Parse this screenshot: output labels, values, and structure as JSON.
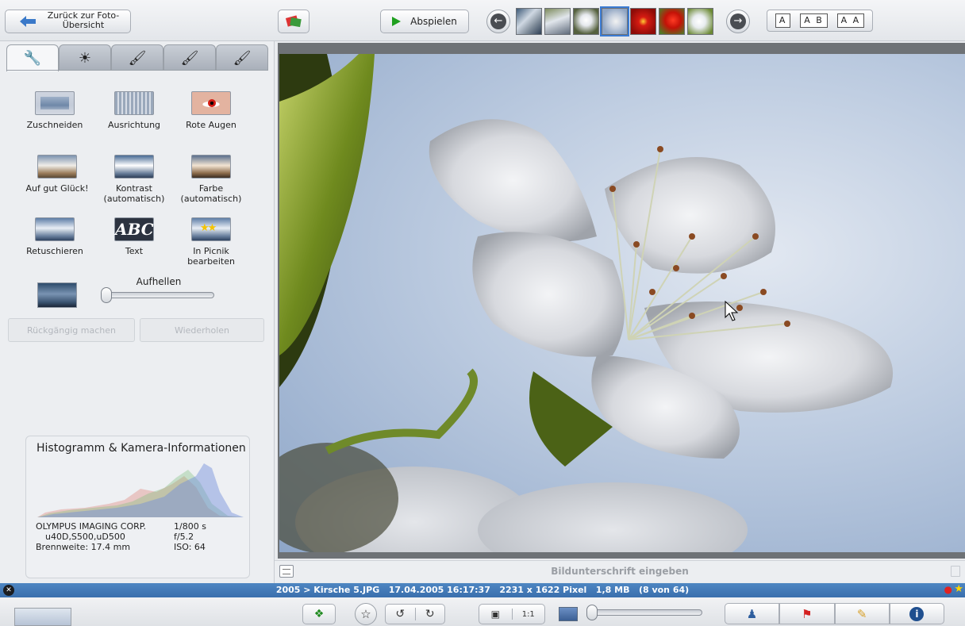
{
  "toolbar": {
    "back_label": "Zurück zur Foto-\nÜbersicht",
    "play_label": "Abspielen",
    "layout_options": [
      "A",
      "A B",
      "A A"
    ],
    "filmstrip": [
      {
        "name": "thumbnail-1"
      },
      {
        "name": "thumbnail-2"
      },
      {
        "name": "thumbnail-3"
      },
      {
        "name": "thumbnail-4",
        "selected": true
      },
      {
        "name": "thumbnail-5"
      },
      {
        "name": "thumbnail-6"
      },
      {
        "name": "thumbnail-7"
      }
    ]
  },
  "edit_panel": {
    "tabs": [
      {
        "icon": "wrench-icon",
        "glyph": "⚒"
      },
      {
        "icon": "sun-icon",
        "glyph": "✹"
      },
      {
        "icon": "brush-icon",
        "glyph": "✒"
      },
      {
        "icon": "brush-picture-icon",
        "glyph": "✒"
      },
      {
        "icon": "brush-picture-blue-icon",
        "glyph": "✒"
      }
    ],
    "tools": [
      {
        "label": "Zuschneiden"
      },
      {
        "label": "Ausrichtung"
      },
      {
        "label": "Rote Augen"
      },
      {
        "label": "Auf gut Glück!"
      },
      {
        "label": "Kontrast\n(automatisch)"
      },
      {
        "label": "Farbe\n(automatisch)"
      },
      {
        "label": "Retuschieren"
      },
      {
        "label": "Text",
        "icon_text": "ABC"
      },
      {
        "label": "In Picnik\nbearbeiten"
      }
    ],
    "fill_light_label": "Aufhellen",
    "fill_light_value": 0,
    "undo_label": "Rückgängig machen",
    "redo_label": "Wiederholen"
  },
  "histogram": {
    "title": "Histogramm & Kamera-Informationen",
    "camera_lines": [
      "OLYMPUS IMAGING CORP.",
      "u40D,S500,uD500",
      "Brennweite: 17.4 mm"
    ],
    "exposure_lines": [
      "1/800 s",
      "f/5.2",
      "ISO: 64"
    ]
  },
  "caption": {
    "placeholder": "Bildunterschrift eingeben"
  },
  "status": {
    "path": "2005 > Kirsche 5.JPG",
    "datetime": "17.04.2005 16:17:37",
    "dimensions": "2231 x 1622 Pixel",
    "size": "1,8 MB",
    "position": "(8 von 64)",
    "full_text": "2005 > Kirsche 5.JPG   17.04.2005 16:17:37   2231 x 1622 Pixel   1,8 MB   (8 von 64)"
  },
  "bottom_toolbar": {
    "zoom_value": 0,
    "view_actual_label": "1:1"
  },
  "colors": {
    "statusbar": "#3f75b3",
    "play_green": "#1fa01f",
    "selection_blue": "#3b7bd3"
  }
}
